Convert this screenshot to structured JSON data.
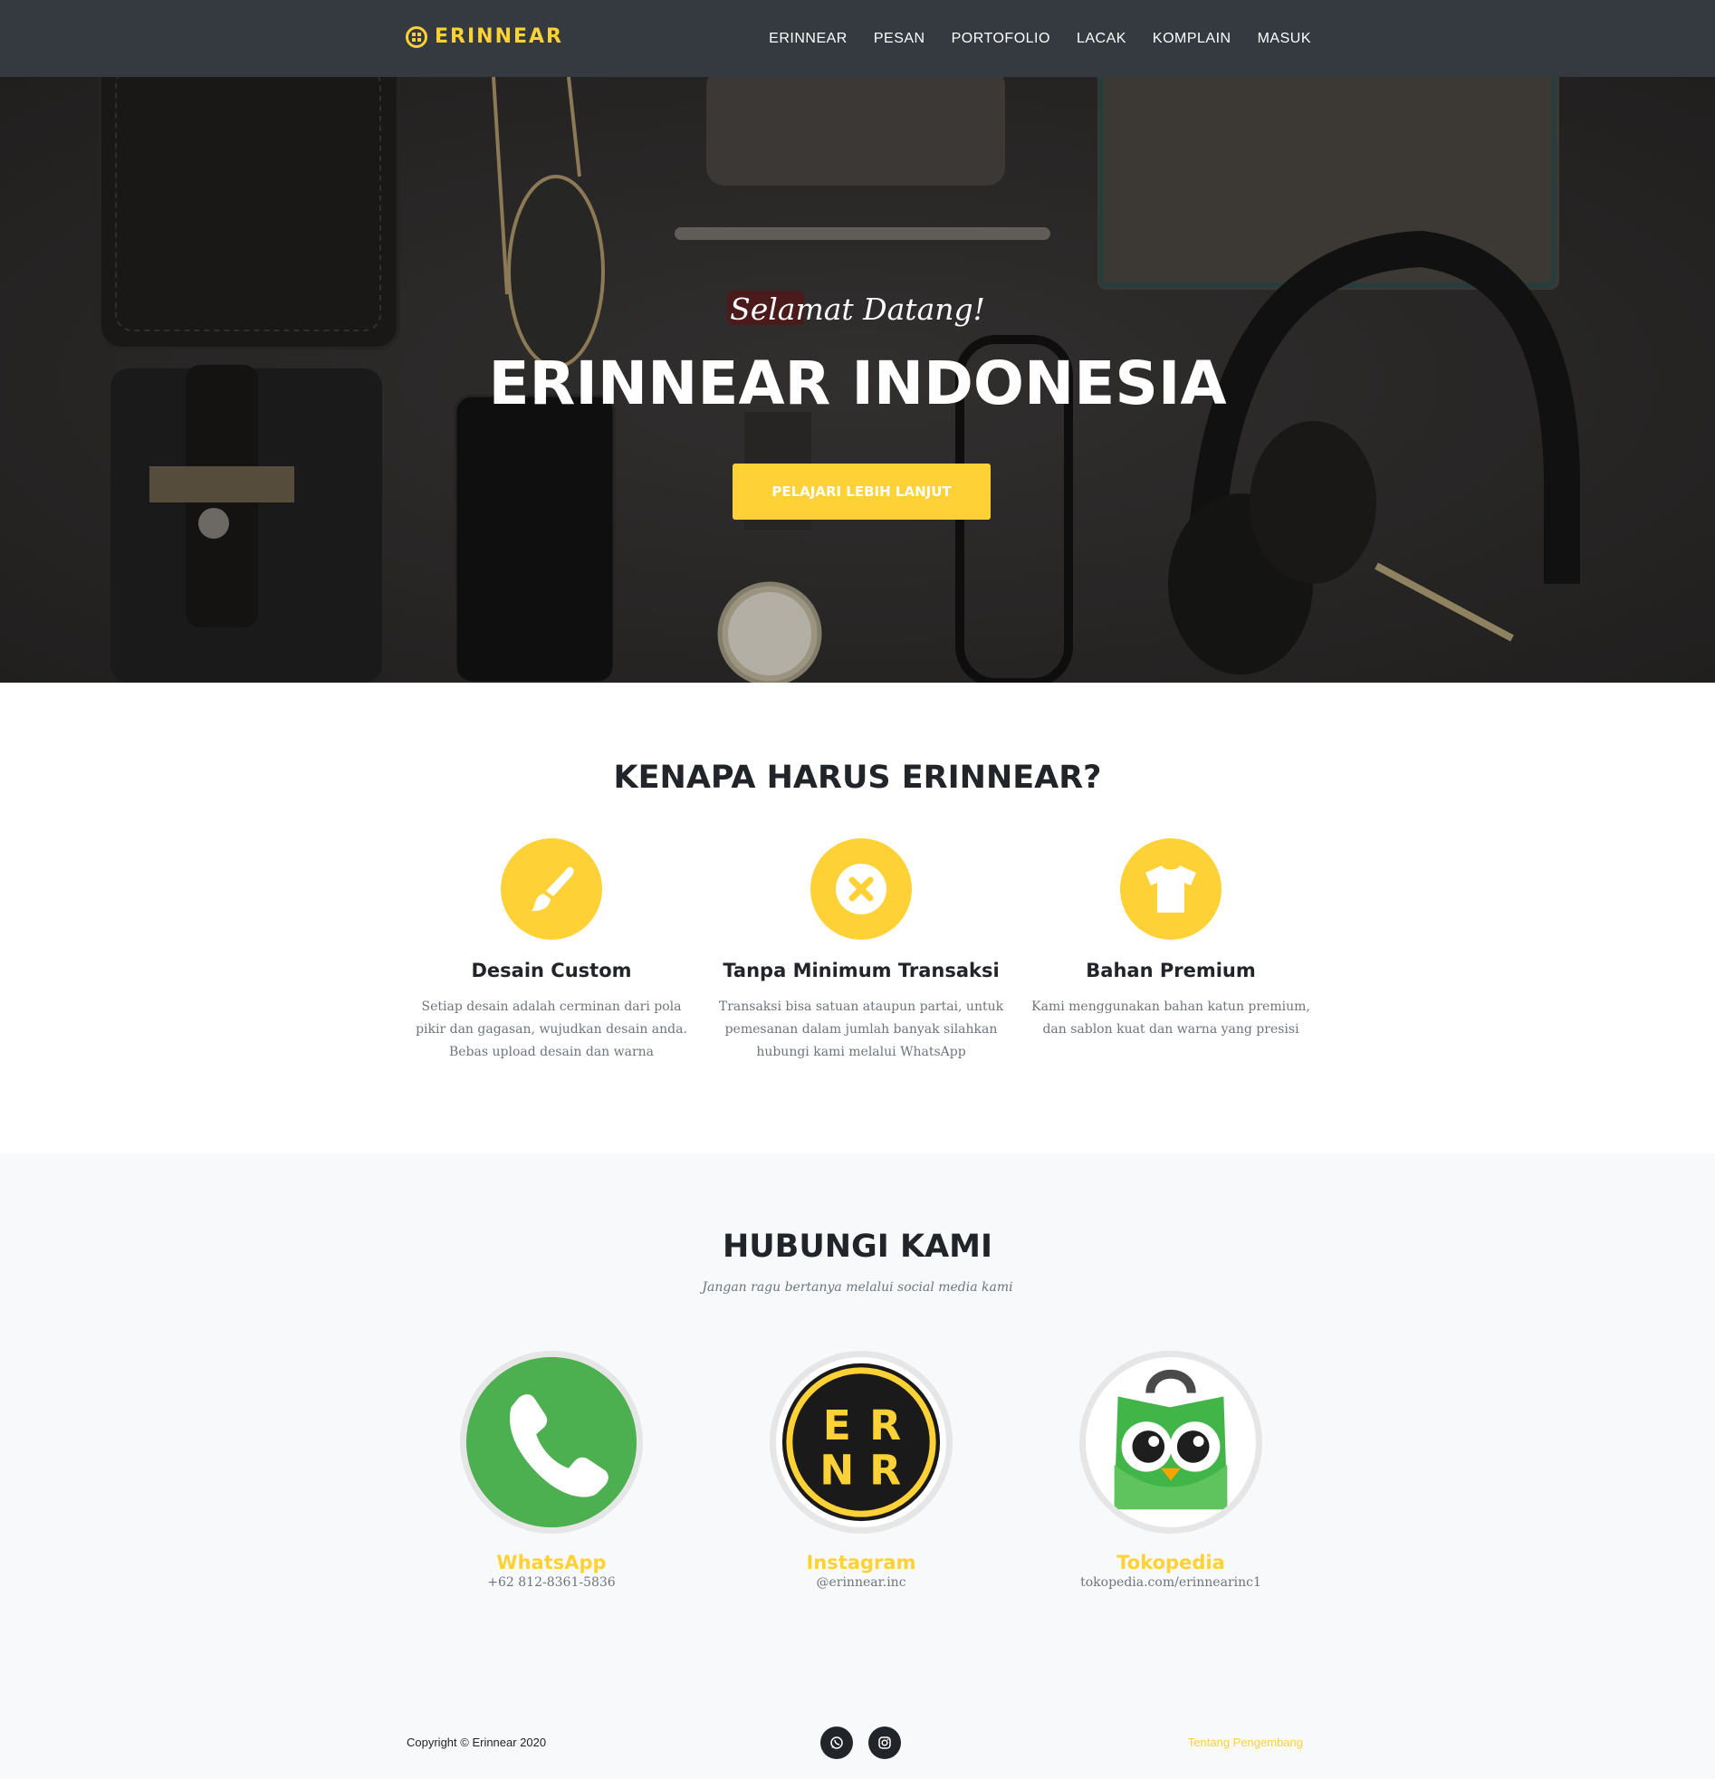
{
  "brand": {
    "name": "ERINNEAR",
    "mark": "ER NR",
    "color": "#fed136"
  },
  "nav": {
    "items": [
      {
        "label": "ERINNEAR"
      },
      {
        "label": "PESAN"
      },
      {
        "label": "PORTOFOLIO"
      },
      {
        "label": "LACAK"
      },
      {
        "label": "KOMPLAIN"
      },
      {
        "label": "MASUK"
      }
    ]
  },
  "hero": {
    "subtitle": "Selamat Datang!",
    "title": "ERINNEAR INDONESIA",
    "button_label": "PELAJARI LEBIH LANJUT"
  },
  "features": {
    "heading": "KENAPA HARUS ERINNEAR?",
    "items": [
      {
        "icon": "paintbrush-icon",
        "title": "Desain Custom",
        "text": "Setiap desain adalah cerminan dari pola pikir dan gagasan, wujudkan desain anda. Bebas upload desain dan warna"
      },
      {
        "icon": "close-circle-icon",
        "title": "Tanpa Minimum Transaksi",
        "text": "Transaksi bisa satuan ataupun partai, untuk pemesanan dalam jumlah banyak silahkan hubungi kami melalui WhatsApp"
      },
      {
        "icon": "tshirt-icon",
        "title": "Bahan Premium",
        "text": "Kami menggunakan bahan katun premium, dan sablon kuat dan warna yang presisi"
      }
    ]
  },
  "contact": {
    "heading": "HUBUNGI KAMI",
    "subheading": "Jangan ragu bertanya melalui social media kami",
    "items": [
      {
        "icon": "whatsapp-icon",
        "name": "WhatsApp",
        "detail": "+62 812-8361-5836",
        "color": "#4caf50"
      },
      {
        "icon": "instagram-logo-icon",
        "name": "Instagram",
        "detail": "@erinnear.inc",
        "logo_text": [
          "E",
          "R",
          "N",
          "R"
        ]
      },
      {
        "icon": "tokopedia-owl-icon",
        "name": "Tokopedia",
        "detail": "tokopedia.com/erinnearinc1",
        "color": "#42b549"
      }
    ]
  },
  "footer": {
    "copyright": "Copyright © Erinnear 2020",
    "social": [
      "whatsapp-icon",
      "instagram-icon"
    ],
    "link": "Tentang Pengembang"
  }
}
